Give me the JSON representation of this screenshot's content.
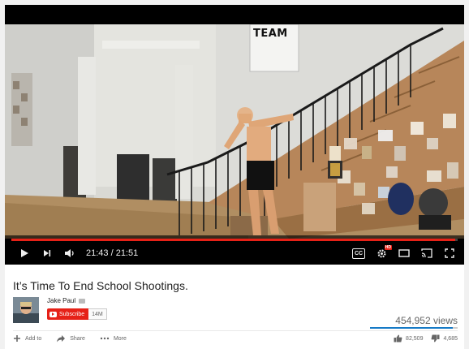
{
  "player": {
    "time_display": "21:43 / 21:51",
    "progress": 0.9939,
    "scene_sign_text": "TEAM",
    "cc_label": "CC",
    "hd_badge": "HD",
    "colors": {
      "progress": "#e62117",
      "controls_text": "#eeeeee"
    },
    "icons": {
      "play": "play-icon",
      "next": "next-icon",
      "volume": "volume-icon",
      "captions": "captions-icon",
      "settings": "settings-gear-icon",
      "theater": "theater-mode-icon",
      "cast": "cast-icon",
      "fullscreen": "fullscreen-icon"
    }
  },
  "video": {
    "title": "It’s Time To End School Shootings.",
    "channel_name": "Jake Paul",
    "subscribe_label": "Subscribe",
    "subscriber_count": "14M",
    "views": "454,952 views",
    "actions": {
      "add_to": "Add to",
      "share": "Share",
      "more": "More"
    },
    "likes": "82,509",
    "dislikes": "4,685",
    "colors": {
      "subscribe": "#e62117",
      "like_bar": "#167ac6"
    }
  }
}
